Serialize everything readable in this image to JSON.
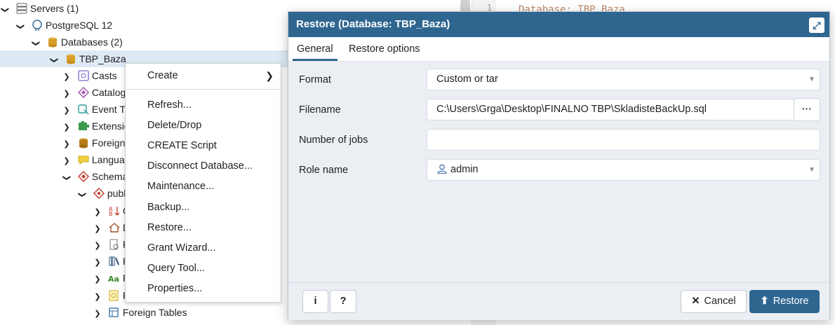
{
  "tree": {
    "items": [
      {
        "label": "Servers (1)",
        "icon": "servers-icon"
      },
      {
        "label": "PostgreSQL 12",
        "icon": "postgres-elephant-icon"
      },
      {
        "label": "Databases (2)",
        "icon": "databases-icon"
      },
      {
        "label": "TBP_Baza",
        "icon": "database-icon"
      },
      {
        "label": "Casts",
        "icon": "casts-icon"
      },
      {
        "label": "Catalog",
        "icon": "catalogs-icon"
      },
      {
        "label": "Event Tr",
        "icon": "event-trigger-icon"
      },
      {
        "label": "Extensio",
        "icon": "extension-icon"
      },
      {
        "label": "Foreign",
        "icon": "foreign-data-wrapper-icon"
      },
      {
        "label": "Langua",
        "icon": "language-icon"
      },
      {
        "label": "Schema",
        "icon": "schemas-icon"
      },
      {
        "label": "publ",
        "icon": "schema-icon"
      },
      {
        "label": "C",
        "icon": "collation-icon"
      },
      {
        "label": "D",
        "icon": "domain-icon"
      },
      {
        "label": "F",
        "icon": "fts-configuration-icon"
      },
      {
        "label": "F",
        "icon": "fts-dictionary-icon"
      },
      {
        "label": "F",
        "icon": "fts-parser-icon"
      },
      {
        "label": "F",
        "icon": "fts-template-icon"
      },
      {
        "label": "Foreign Tables",
        "icon": "foreign-table-icon"
      }
    ]
  },
  "editor": {
    "line_number": "1",
    "code_text": "Database: TBP_Baza"
  },
  "context_menu": {
    "items": [
      {
        "label": "Create",
        "submenu": true
      },
      {
        "label": "Refresh..."
      },
      {
        "label": "Delete/Drop"
      },
      {
        "label": "CREATE Script"
      },
      {
        "label": "Disconnect Database..."
      },
      {
        "label": "Maintenance..."
      },
      {
        "label": "Backup..."
      },
      {
        "label": "Restore..."
      },
      {
        "label": "Grant Wizard..."
      },
      {
        "label": "Query Tool..."
      },
      {
        "label": "Properties..."
      }
    ]
  },
  "dialog": {
    "title": "Restore (Database: TBP_Baza)",
    "tabs": [
      "General",
      "Restore options"
    ],
    "active_tab": "General",
    "fields": {
      "format": {
        "label": "Format",
        "value": "Custom or tar"
      },
      "filename": {
        "label": "Filename",
        "value": "C:\\Users\\Grga\\Desktop\\FINALNO TBP\\SkladisteBackUp.sql",
        "browse_label": "···"
      },
      "jobs": {
        "label": "Number of jobs",
        "value": ""
      },
      "role": {
        "label": "Role name",
        "value": "admin"
      }
    },
    "footer": {
      "info_label": "i",
      "help_label": "?",
      "cancel_label": "Cancel",
      "restore_label": "Restore"
    }
  },
  "colors": {
    "accent": "#2f6690",
    "selection": "#ddeaf5"
  }
}
